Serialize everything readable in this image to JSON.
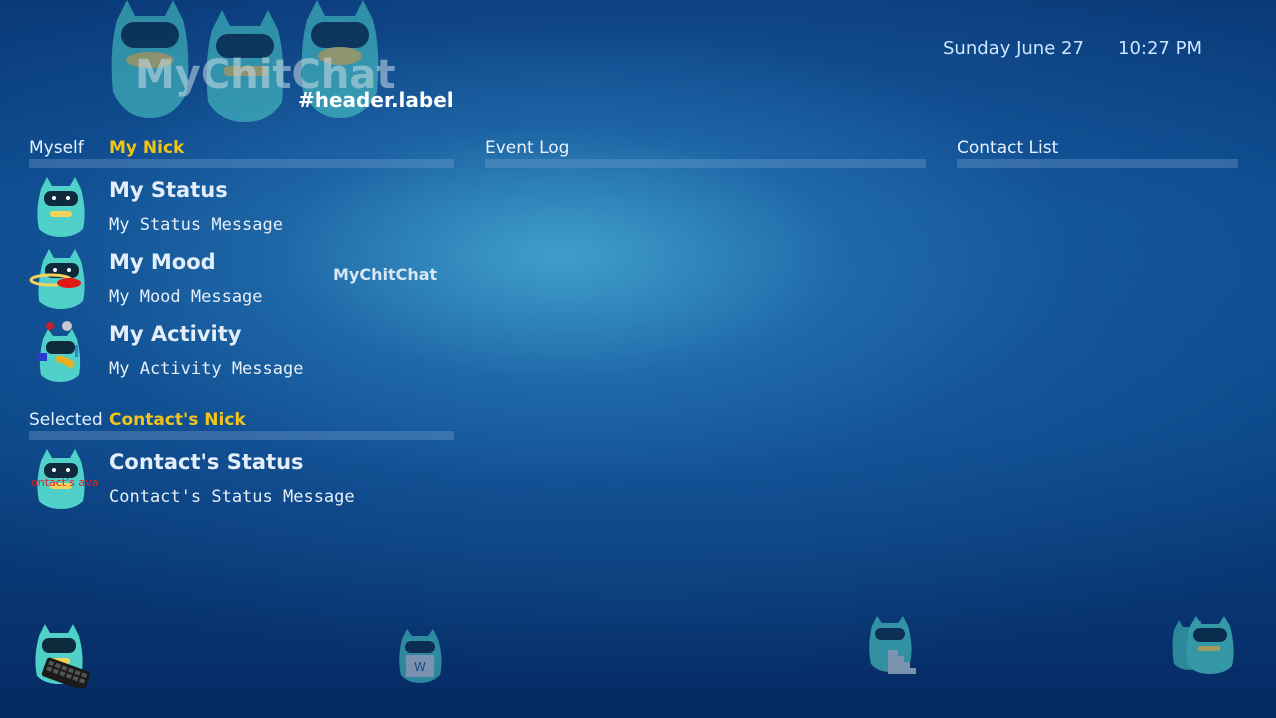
{
  "header": {
    "logo_text": "MyChitChat",
    "label": "#header.label",
    "date": "Sunday June 27",
    "time": "10:27 PM"
  },
  "myself": {
    "section_label": "Myself",
    "nick": "My Nick",
    "status_title": "My Status",
    "status_message": "My Status Message",
    "mood_title": "My Mood",
    "mood_message": "My Mood Message",
    "activity_title": "My Activity",
    "activity_message": "My Activity Message"
  },
  "event_log": {
    "title": "Event Log"
  },
  "contact_list": {
    "title": "Contact List"
  },
  "floating_label": "MyChitChat",
  "selected": {
    "section_label": "Selected",
    "nick": "Contact's Nick",
    "status_title": "Contact's Status",
    "status_message": "Contact's Status Message",
    "avatar_overlay_text": "ontact's ava"
  },
  "colors": {
    "accent_nick": "#f3c418",
    "mascot": "#4fd0c8",
    "background": "#0b4a8c"
  },
  "icons": {
    "header_mascots": "mascot-group-icon",
    "status": "mascot-status-icon",
    "mood": "mascot-mood-icon",
    "activity": "mascot-activity-icon",
    "contact": "mascot-contact-icon",
    "bottom": [
      "mascot-keyboard-icon",
      "mascot-book-icon",
      "mascot-stairs-icon",
      "mascot-group-icon"
    ]
  }
}
